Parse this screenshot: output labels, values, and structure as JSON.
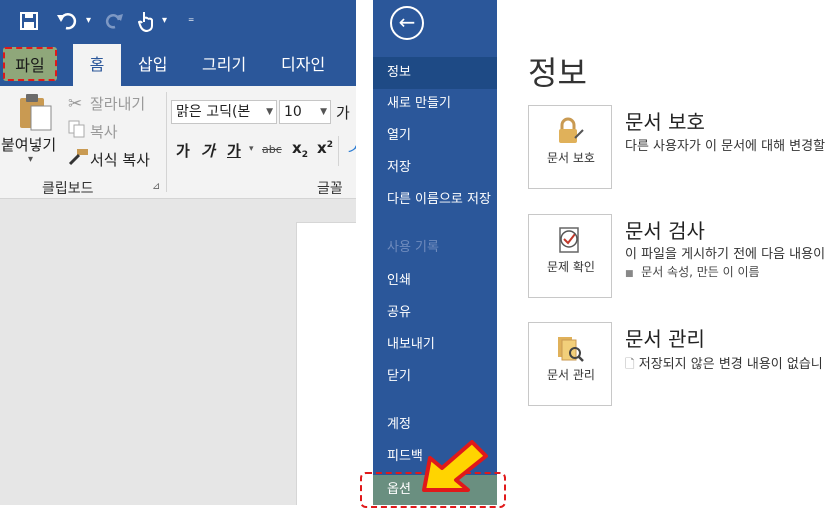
{
  "left": {
    "tabs": {
      "file": "파일",
      "home": "홈",
      "insert": "삽입",
      "draw": "그리기",
      "design": "디자인"
    },
    "clipboard": {
      "paste": "붙여넣기",
      "cut": "잘라내기",
      "copy": "복사",
      "format_painter": "서식 복사",
      "group_label": "클립보드"
    },
    "font": {
      "font_name": "맑은 고딕(본",
      "font_size": "10",
      "grow_font": "가",
      "bold": "가",
      "italic": "가",
      "underline": "가",
      "strike": "abc",
      "subscript": "x",
      "subscript_mark": "2",
      "superscript": "x",
      "superscript_mark": "2",
      "group_label": "글꼴"
    }
  },
  "backstage": {
    "nav": {
      "info": "정보",
      "new": "새로 만들기",
      "open": "열기",
      "save": "저장",
      "save_as": "다른 이름으로 저장",
      "history": "사용 기록",
      "print": "인쇄",
      "share": "공유",
      "export": "내보내기",
      "close": "닫기",
      "account": "계정",
      "feedback": "피드백",
      "options": "옵션"
    },
    "page_title": "정보",
    "sections": [
      {
        "button_label": "문서 보호",
        "title": "문서 보호",
        "description": "다른 사용자가 이 문서에 대해 변경할"
      },
      {
        "button_label": "문제 확인",
        "title": "문서 검사",
        "description": "이 파일을 게시하기 전에 다음 내용이",
        "bullet": "문서 속성, 만든 이 이름"
      },
      {
        "button_label": "문서 관리",
        "title": "문서 관리",
        "description": "저장되지 않은 변경 내용이 없습니"
      }
    ]
  },
  "colors": {
    "word_blue": "#2b579a",
    "highlight_red": "#e0191a",
    "arrow_yellow": "#ffd400"
  }
}
